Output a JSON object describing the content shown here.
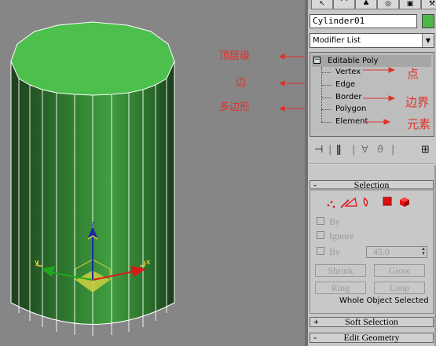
{
  "viewport": {
    "cylinder_color": "#4cbf4c",
    "cylinder_side_dark": "#1d4d1d",
    "gizmo_axes": {
      "z": "z",
      "x": "x",
      "y": "y"
    }
  },
  "tabs": [
    "create-icon",
    "modify-icon",
    "hierarchy-icon",
    "motion-icon",
    "display-icon",
    "utilities-icon"
  ],
  "object": {
    "name": "Cylinder01",
    "color": "#4cb84c"
  },
  "modifier_list": {
    "label": "Modifier List"
  },
  "stack": {
    "root": "Editable Poly",
    "items": [
      "Vertex",
      "Edge",
      "Border",
      "Polygon",
      "Element"
    ]
  },
  "annotations": {
    "editable_poly": "顶层级",
    "vertex": "点",
    "edge": "边",
    "border": "边界",
    "polygon": "多边形",
    "element": "元素"
  },
  "selection": {
    "title": "Selection",
    "collapse_sign": "-",
    "by_vertex": "By",
    "ignore": "Ignore",
    "by_angle": "By",
    "angle_value": "45.0",
    "shrink": "Shrink",
    "grow": "Grow",
    "ring": "Ring",
    "loop": "Loop",
    "status": "Whole Object Selected"
  },
  "soft_selection": {
    "title": "Soft Selection",
    "sign": "+"
  },
  "edit_geometry": {
    "title": "Edit Geometry",
    "sign": "-"
  },
  "accent": {
    "annotation": "#e0322a",
    "active": "#e01010"
  }
}
